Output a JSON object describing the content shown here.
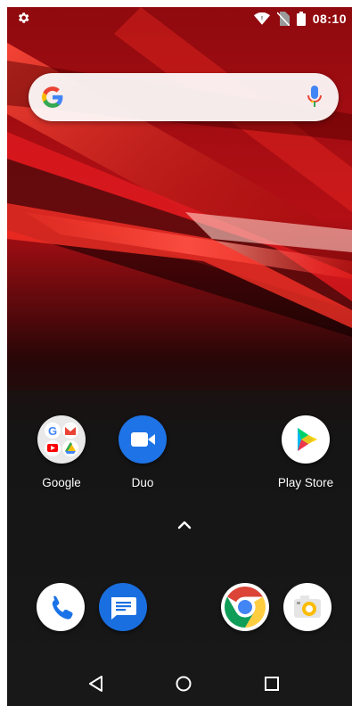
{
  "status_bar": {
    "time": "08:10",
    "icons": [
      "settings-gear-icon",
      "wifi-icon",
      "no-sim-icon",
      "battery-icon"
    ]
  },
  "search_widget": {
    "logo": "google-g-logo",
    "mic_icon": "mic-icon"
  },
  "home_apps": [
    {
      "label": "Google",
      "icon": "google-folder-icon"
    },
    {
      "label": "Duo",
      "icon": "duo-video-icon"
    },
    {
      "label": "Play Store",
      "icon": "play-store-icon"
    }
  ],
  "app_drawer_handle": {
    "icon": "chevron-up-icon"
  },
  "dock": [
    {
      "icon": "phone-icon"
    },
    {
      "icon": "messages-icon"
    },
    {
      "icon": "chrome-icon"
    },
    {
      "icon": "camera-icon"
    }
  ],
  "nav_bar": {
    "buttons": [
      "back-icon",
      "home-icon",
      "recents-icon"
    ]
  },
  "colors": {
    "wallpaper_red": "#c8141c",
    "duo_blue": "#1e73e6",
    "messages_blue": "#1a6fe0",
    "phone_blue": "#1b73e8"
  }
}
